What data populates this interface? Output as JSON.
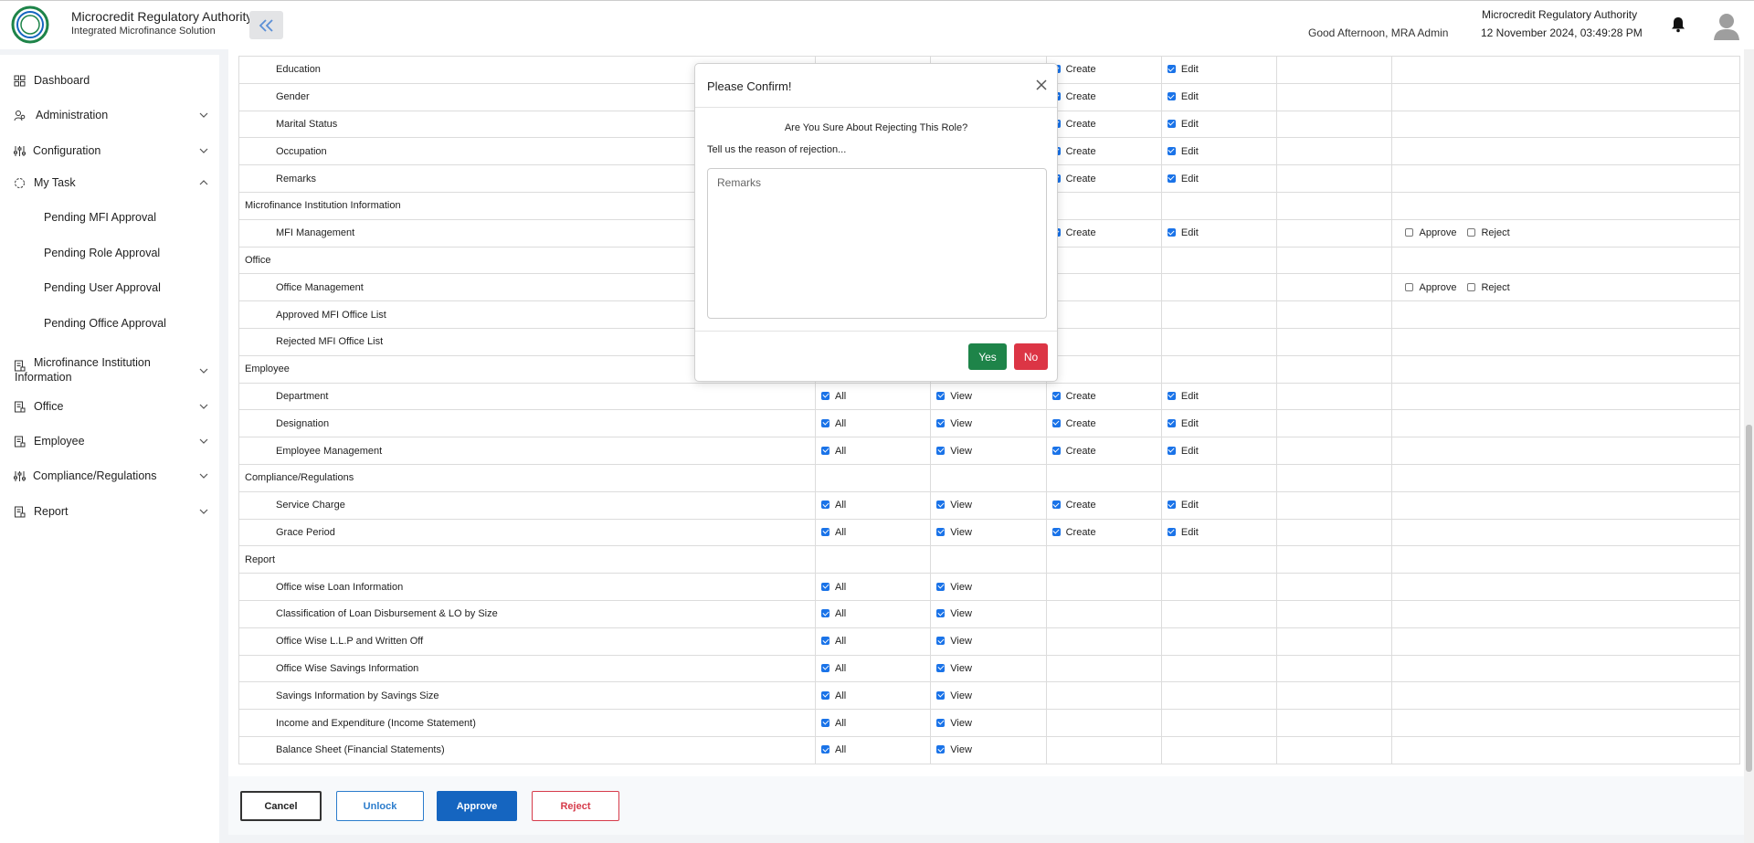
{
  "header": {
    "brand_title": "Microcredit Regulatory Authority",
    "brand_subtitle": "Integrated Microfinance Solution",
    "logo_text": "Microcredit Regulatory Authority",
    "greeting": "Good Afternoon, MRA Admin",
    "org_name": "Microcredit Regulatory Authority",
    "datetime": "12 November 2024, 03:49:28 PM"
  },
  "sidebar": {
    "dashboard": "Dashboard",
    "administration": "Administration",
    "configuration": "Configuration",
    "my_task": "My Task",
    "sub": [
      "Pending MFI Approval",
      "Pending Role Approval",
      "Pending User Approval",
      "Pending Office Approval"
    ],
    "mfi_info_1": "Microfinance Institution",
    "mfi_info_2": "Information",
    "office": "Office",
    "employee": "Employee",
    "compliance": "Compliance/Regulations",
    "report": "Report"
  },
  "labels": {
    "all": "All",
    "view": "View",
    "create": "Create",
    "edit": "Edit",
    "approve": "Approve",
    "reject": "Reject"
  },
  "table_rows": [
    {
      "name": "Education",
      "type": "item",
      "create": true,
      "edit": true
    },
    {
      "name": "Gender",
      "type": "item",
      "create": true,
      "edit": true
    },
    {
      "name": "Marital Status",
      "type": "item",
      "create": true,
      "edit": true
    },
    {
      "name": "Occupation",
      "type": "item",
      "create": true,
      "edit": true
    },
    {
      "name": "Remarks",
      "type": "item",
      "create": true,
      "edit": true
    },
    {
      "name": "Microfinance Institution Information",
      "type": "section"
    },
    {
      "name": "MFI Management",
      "type": "item",
      "create": true,
      "edit": true,
      "approval": true
    },
    {
      "name": "Office",
      "type": "section"
    },
    {
      "name": "Office Management",
      "type": "item",
      "approval": true
    },
    {
      "name": "Approved MFI Office List",
      "type": "item"
    },
    {
      "name": "Rejected MFI Office List",
      "type": "item"
    },
    {
      "name": "Employee",
      "type": "section"
    },
    {
      "name": "Department",
      "type": "item",
      "all": true,
      "view": true,
      "create": true,
      "edit": true
    },
    {
      "name": "Designation",
      "type": "item",
      "all": true,
      "view": true,
      "create": true,
      "edit": true
    },
    {
      "name": "Employee Management",
      "type": "item",
      "all": true,
      "view": true,
      "create": true,
      "edit": true
    },
    {
      "name": "Compliance/Regulations",
      "type": "section"
    },
    {
      "name": "Service Charge",
      "type": "item",
      "all": true,
      "view": true,
      "create": true,
      "edit": true
    },
    {
      "name": "Grace Period",
      "type": "item",
      "all": true,
      "view": true,
      "create": true,
      "edit": true
    },
    {
      "name": "Report",
      "type": "section"
    },
    {
      "name": "Office wise Loan Information",
      "type": "item",
      "all": true,
      "view": true
    },
    {
      "name": "Classification of Loan Disbursement & LO by Size",
      "type": "item",
      "all": true,
      "view": true
    },
    {
      "name": "Office Wise L.L.P and Written Off",
      "type": "item",
      "all": true,
      "view": true
    },
    {
      "name": "Office Wise Savings Information",
      "type": "item",
      "all": true,
      "view": true
    },
    {
      "name": "Savings Information by Savings Size",
      "type": "item",
      "all": true,
      "view": true
    },
    {
      "name": "Income and Expenditure (Income Statement)",
      "type": "item",
      "all": true,
      "view": true
    },
    {
      "name": "Balance Sheet (Financial Statements)",
      "type": "item",
      "all": true,
      "view": true
    }
  ],
  "footer": {
    "cancel": "Cancel",
    "unlock": "Unlock",
    "approve": "Approve",
    "reject": "Reject"
  },
  "modal": {
    "title": "Please Confirm!",
    "question": "Are You Sure About Rejecting This Role?",
    "reason_label": "Tell us the reason of rejection...",
    "remarks_placeholder": "Remarks",
    "remarks_value": "",
    "yes": "Yes",
    "no": "No"
  },
  "colors": {
    "primary": "#1565c0",
    "success": "#1e8449",
    "danger": "#dc3545",
    "checkbox": "#1a73e8"
  }
}
